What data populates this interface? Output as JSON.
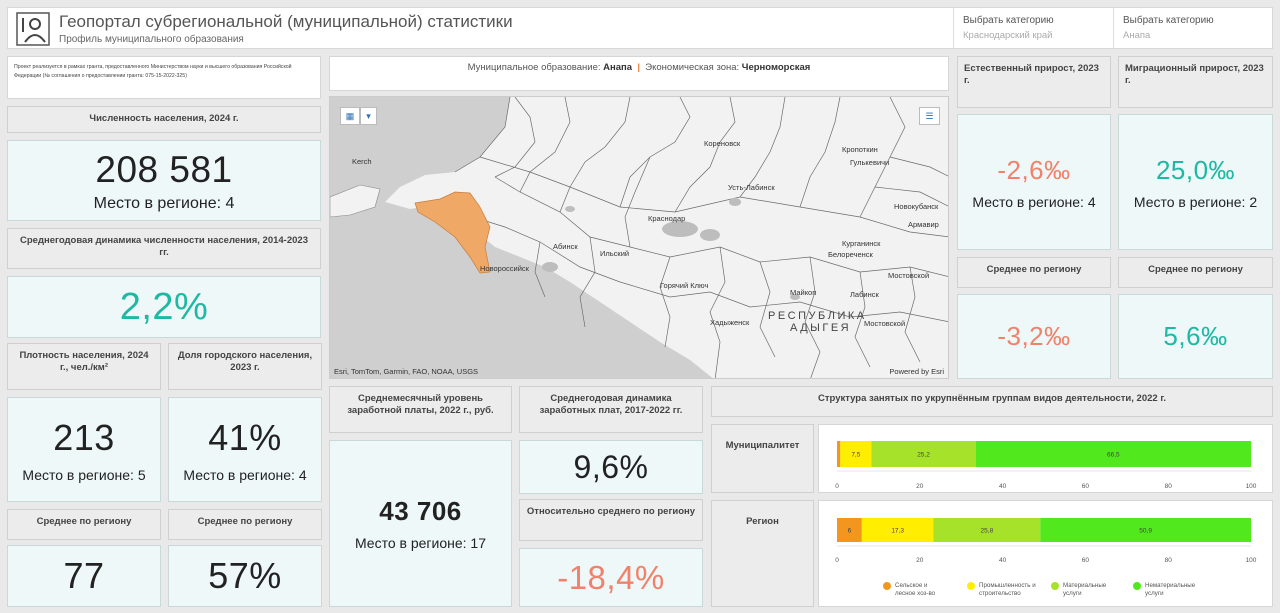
{
  "header": {
    "title": "Геопортал субрегиональной (муниципальной) статистики",
    "subtitle": "Профиль муниципального образования",
    "selector1": {
      "label": "Выбрать категорию",
      "value": "Краснодарский край"
    },
    "selector2": {
      "label": "Выбрать категорию",
      "value": "Анапа"
    }
  },
  "grant_text": "Проект реализуется в рамках гранта, предоставленного Министерством науки и высшего образования Российской Федерации (№ соглашения о предоставлении гранта: 075-15-2022-325)",
  "infobar": {
    "mo_label": "Муниципальное образование:",
    "mo_value": "Анапа",
    "sep": "|",
    "zone_label": "Экономическая зона:",
    "zone_value": "Черноморская"
  },
  "population": {
    "title": "Численность населения, 2024 г.",
    "value": "208 581",
    "rank": "Место в регионе: 4"
  },
  "pop_dynamics": {
    "title": "Среднегодовая динамика численности населения, 2014-2023 гг.",
    "value": "2,2%"
  },
  "density": {
    "title": "Плотность населения, 2024 г., чел./км²",
    "value": "213",
    "rank": "Место в регионе: 5",
    "avg_title": "Среднее по региону",
    "avg_value": "77"
  },
  "urban": {
    "title": "Доля городского населения, 2023 г.",
    "value": "41%",
    "rank": "Место в регионе: 4",
    "avg_title": "Среднее по региону",
    "avg_value": "57%"
  },
  "salary": {
    "title": "Среднемесячный уровень заработной платы, 2022 г., руб.",
    "value": "43 706",
    "rank": "Место в регионе: 17"
  },
  "salary_dynamics": {
    "title": "Среднегодовая динамика заработных плат, 2017-2022 гг.",
    "value": "9,6%",
    "rel_title": "Относительно среднего по региону",
    "rel_value": "-18,4%"
  },
  "natural_growth": {
    "title": "Естественный прирост, 2023 г.",
    "value": "-2,6‰",
    "rank": "Место в регионе: 4",
    "avg_title": "Среднее по региону",
    "avg_value": "-3,2‰"
  },
  "migration": {
    "title": "Миграционный прирост, 2023 г.",
    "value": "25,0‰",
    "rank": "Место в регионе: 2",
    "avg_title": "Среднее по региону",
    "avg_value": "5,6‰"
  },
  "map": {
    "attribution": "Esri, TomTom, Garmin, FAO, NOAA, USGS",
    "powered": "Powered by Esri",
    "labels": [
      {
        "text": "Kerch"
      },
      {
        "text": "Кореновск"
      },
      {
        "text": "Кропоткин"
      },
      {
        "text": "Гулькевичи"
      },
      {
        "text": "Усть-Лабинск"
      },
      {
        "text": "Новокубанск"
      },
      {
        "text": "Краснодар"
      },
      {
        "text": "Армавир"
      },
      {
        "text": "Абинск"
      },
      {
        "text": "Курганинск"
      },
      {
        "text": "Новороссийск"
      },
      {
        "text": "Ильский"
      },
      {
        "text": "Белореченск"
      },
      {
        "text": "Мостовской"
      },
      {
        "text": "Горячий Ключ"
      },
      {
        "text": "Майкоп"
      },
      {
        "text": "Лабинск"
      },
      {
        "text": "Хадыженск"
      },
      {
        "text": "Мостовской"
      },
      {
        "text": "РЕСПУБЛИКА"
      },
      {
        "text": "АДЫГЕЯ"
      },
      {
        "text": "Мостовской"
      }
    ],
    "icons": {
      "layers": "layers-icon",
      "dropdown": "chevron-down-icon",
      "legend": "legend-list-icon"
    }
  },
  "employment": {
    "title": "Структура занятых по укрупнённым группам видов деятельности, 2022 г.",
    "row1_label": "Муниципалитет",
    "row2_label": "Регион",
    "axis_ticks": [
      "0",
      "20",
      "40",
      "60",
      "80",
      "100"
    ]
  },
  "chart_data": {
    "type": "bar",
    "title": "Структура занятых по укрупнённым группам видов деятельности, 2022 г.",
    "orientation": "horizontal-stacked",
    "categories": [
      "Муниципалитет",
      "Регион"
    ],
    "series": [
      {
        "name": "Сельское и лесное хоз-во",
        "color": "#f2961e",
        "values": [
          0.8,
          6
        ]
      },
      {
        "name": "Промышленность и строительство",
        "color": "#ffee00",
        "values": [
          7.5,
          17.3
        ]
      },
      {
        "name": "Материальные услуги",
        "color": "#a6e22a",
        "values": [
          25.2,
          25.8
        ]
      },
      {
        "name": "Нематериальные услуги",
        "color": "#52e81e",
        "values": [
          66.5,
          50.9
        ]
      }
    ],
    "data_labels": [
      [
        "",
        "7,5",
        "25,2",
        "66,5"
      ],
      [
        "6",
        "17,3",
        "25,8",
        "50,9"
      ]
    ],
    "xlim": [
      0,
      100
    ],
    "xticks": [
      "0",
      "20",
      "40",
      "60",
      "80",
      "100"
    ],
    "legend": "bottom"
  }
}
